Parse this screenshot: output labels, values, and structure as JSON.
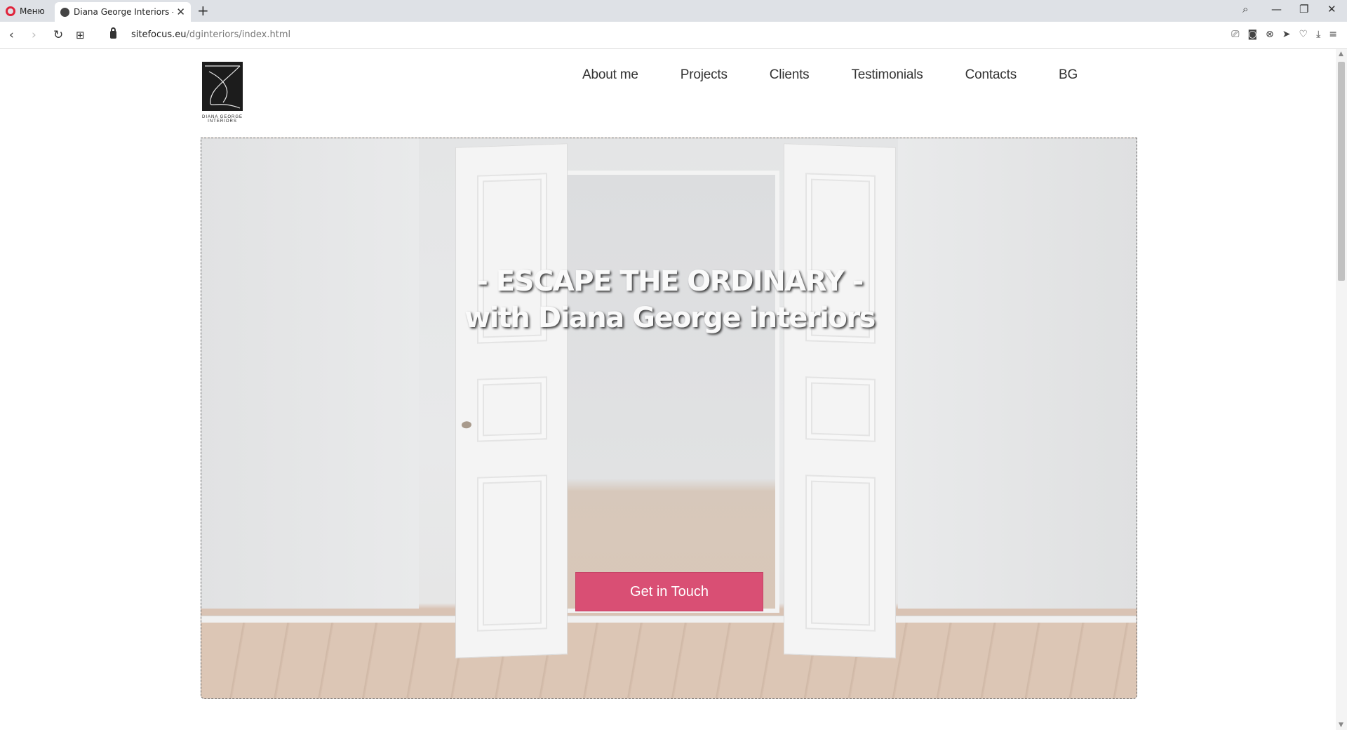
{
  "browser": {
    "menu_label": "Меню",
    "tab_title": "Diana George Interiors - Es",
    "tab_close": "✕",
    "new_tab": "+",
    "url_host": "sitefocus.eu",
    "url_path": "/dginteriors/index.html",
    "search_icon": "⌕",
    "minimize_icon": "—",
    "restore_icon": "❐",
    "close_icon": "✕",
    "back_icon": "‹",
    "forward_icon": "›",
    "reload_icon": "↻",
    "speed_dial_icon": "⊞",
    "snapshot_icon": "⎚",
    "camera_icon": "◙",
    "adblock_icon": "⊗",
    "send_icon": "➤",
    "heart_icon": "♡",
    "download_icon": "⤓",
    "easy_setup_icon": "≡"
  },
  "site": {
    "logo_line1": "DIANA GEORGE",
    "logo_line2": "INTERIORS",
    "nav": [
      "About me",
      "Projects",
      "Clients",
      "Testimonials",
      "Contacts",
      "BG"
    ]
  },
  "hero": {
    "headline_line1": "- ESCAPE THE ORDINARY -",
    "headline_line2": "with Diana George interiors",
    "cta_label": "Get in Touch",
    "cta_color": "#d94f74"
  }
}
